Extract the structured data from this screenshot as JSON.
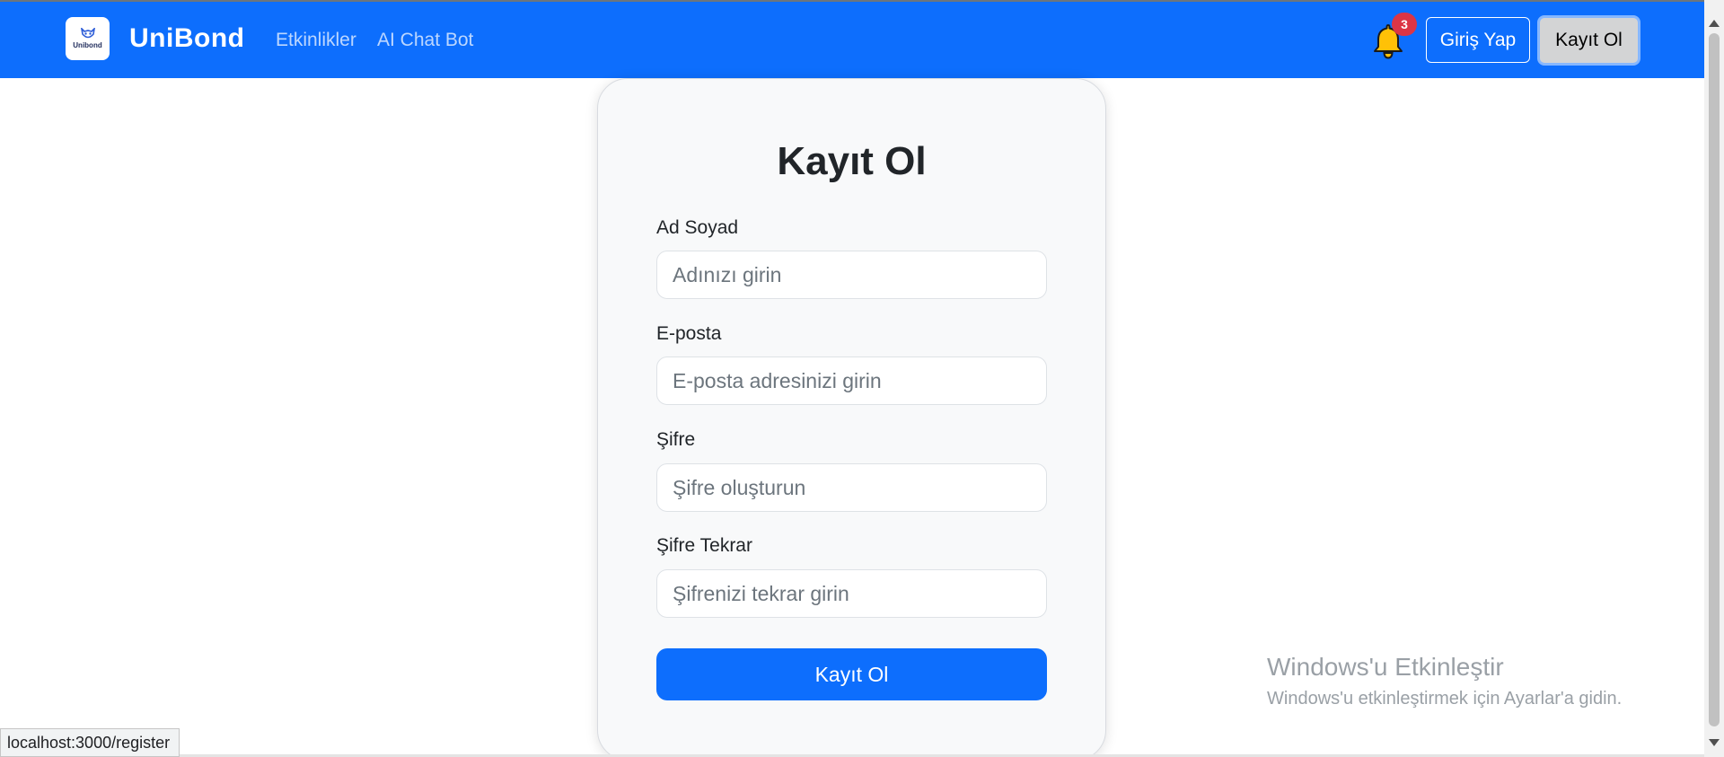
{
  "nav": {
    "brand": "UniBond",
    "logo_text": "Unibond",
    "links": [
      "Etkinlikler",
      "AI Chat Bot"
    ],
    "notification_count": "3",
    "login_label": "Giriş Yap",
    "register_label": "Kayıt Ol"
  },
  "form": {
    "title": "Kayıt Ol",
    "fields": [
      {
        "label": "Ad Soyad",
        "placeholder": "Adınızı girin"
      },
      {
        "label": "E-posta",
        "placeholder": "E-posta adresinizi girin"
      },
      {
        "label": "Şifre",
        "placeholder": "Şifre oluşturun"
      },
      {
        "label": "Şifre Tekrar",
        "placeholder": "Şifrenizi tekrar girin"
      }
    ],
    "submit_label": "Kayıt Ol"
  },
  "watermark": {
    "title": "Windows'u Etkinleştir",
    "subtitle": "Windows'u etkinleştirmek için Ayarlar'a gidin."
  },
  "status_bar": {
    "url": "localhost:3000/register"
  },
  "colors": {
    "primary": "#0d6efd",
    "badge": "#dc3545",
    "bell": "#ffc107",
    "card_bg": "#f8f9fa"
  },
  "icons": {
    "notification": "bell-icon",
    "logo": "owl-logo-icon"
  }
}
